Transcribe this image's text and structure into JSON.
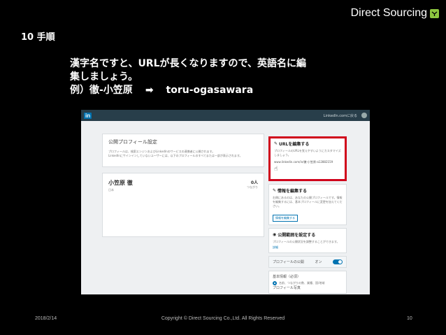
{
  "brand": {
    "name": "Direct Sourcing"
  },
  "slide": {
    "title": "10 手順",
    "line1": "漢字名ですと、URLが長くなりますので、英語名に編",
    "line2": "集しましょう。",
    "example_prefix": "例）徹-小笠原",
    "example_result": "toru-ogasawara"
  },
  "screenshot": {
    "logo": "in",
    "header_user": "LinkedIn.comに戻る",
    "settings_title": "公開プロフィール設定",
    "settings_line1": "プロフィールは、検索エンジンおよびLinkedInのサービスの連携者に公開されます。",
    "settings_line2": "LinkedInにサインインしていないユーザーには、以下のプロフィールのすべてまたは一部が表示されます。",
    "profile_name": "小笠原 徹",
    "profile_location": "日本",
    "connections_count": "0人",
    "connections_label": "つながり",
    "url_title": "URLを編集する",
    "url_text": "プロフィールのURLを覚えやすいようにカスタマイズしましょう。",
    "url_value": "www.linkedin.com/in/徹-小笠原-a12882159",
    "info_title": "情報を編集する",
    "info_text": "右側にあるのは、あなたの公開プロフィールです。情報を編集するには、基本プロフィールに変更を加えてください。",
    "info_button": "情報を編集する",
    "scope_title": "公開範囲を設定する",
    "scope_text": "プロフィールの公開状況を調整することができます。",
    "scope_link": "詳細",
    "toggle_label": "プロフィールの公開",
    "toggle_state": "オン",
    "basic_info": "基本情報（必須）",
    "basic_detail": "名前、つながりの数、業種、国/地域",
    "photo_label": "プロフィール写真"
  },
  "footer": {
    "date": "2018/2/14",
    "copyright": "Copyright © Direct Sourcing Co.,Ltd. All Rights Reserved",
    "page": "10"
  }
}
